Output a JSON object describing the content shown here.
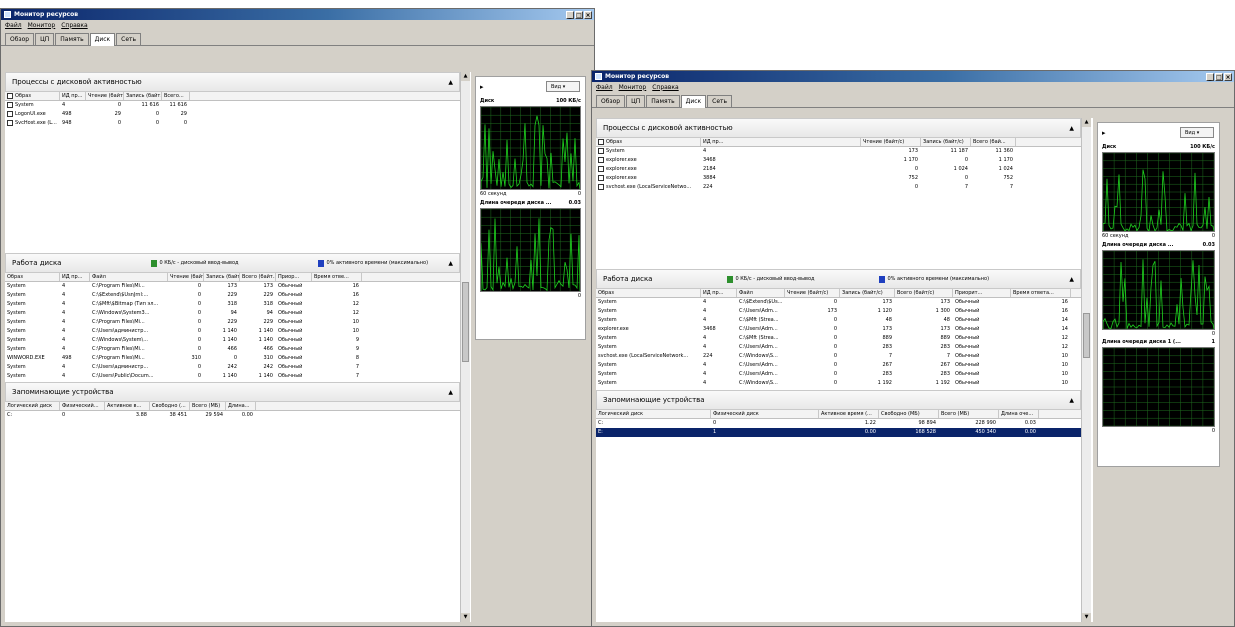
{
  "windows": [
    {
      "title": "Монитор ресурсов",
      "menu": [
        "Файл",
        "Монитор",
        "Справка"
      ],
      "tabs": [
        "Обзор",
        "ЦП",
        "Память",
        "Диск",
        "Сеть"
      ],
      "active_tab": 3,
      "processes": {
        "header": "Процессы с дисковой активностью",
        "columns": [
          "Образ",
          "ИД пр...",
          "Чтение (байт...",
          "Запись (байт...",
          "Всего..."
        ],
        "rows": [
          [
            "System",
            "4",
            "0",
            "11 616",
            "11 616"
          ],
          [
            "LogonUI.exe",
            "498",
            "29",
            "0",
            "29"
          ],
          [
            "SvcHost.exe (L...",
            "948",
            "0",
            "0",
            "0"
          ]
        ]
      },
      "disk": {
        "header": "Работа диска",
        "legend_io": "0 КБ/с - дисковый ввод-вывод",
        "legend_active": "0% активного времени (максимально)",
        "columns": [
          "Образ",
          "ИД пр...",
          "Файл",
          "Чтение (байт...",
          "Запись (байт...",
          "Всего (байт...",
          "Приор...",
          "Время отве..."
        ],
        "rows": [
          [
            "System",
            "4",
            "C:\\Program Files\\Mi...",
            "0",
            "173",
            "173",
            "Обычный",
            "16"
          ],
          [
            "System",
            "4",
            "C:\\$Extend\\$UsnJrnl:...",
            "0",
            "229",
            "229",
            "Обычный",
            "16"
          ],
          [
            "System",
            "4",
            "C:\\$Mft\\$Bitmap (Тип эл...",
            "0",
            "318",
            "318",
            "Обычный",
            "12"
          ],
          [
            "System",
            "4",
            "C:\\Windows\\System3...",
            "0",
            "94",
            "94",
            "Обычный",
            "12"
          ],
          [
            "System",
            "4",
            "C:\\Program Files\\Mi...",
            "0",
            "229",
            "229",
            "Обычный",
            "10"
          ],
          [
            "System",
            "4",
            "C:\\Users\\администр...",
            "0",
            "1 140",
            "1 140",
            "Обычный",
            "10"
          ],
          [
            "System",
            "4",
            "C:\\Windows\\System\\...",
            "0",
            "1 140",
            "1 140",
            "Обычный",
            "9"
          ],
          [
            "System",
            "4",
            "C:\\Program Files\\Mi...",
            "0",
            "466",
            "466",
            "Обычный",
            "9"
          ],
          [
            "WINWORD.EXE",
            "498",
            "C:\\Program Files\\Mi...",
            "310",
            "0",
            "310",
            "Обычный",
            "8"
          ],
          [
            "System",
            "4",
            "C:\\Users\\администр...",
            "0",
            "242",
            "242",
            "Обычный",
            "7"
          ],
          [
            "System",
            "4",
            "C:\\Users\\Public\\Docum...",
            "0",
            "1 140",
            "1 140",
            "Обычный",
            "7"
          ]
        ]
      },
      "storage": {
        "header": "Запоминающие устройства",
        "columns": [
          "Логический диск",
          "Физический...",
          "Активное в...",
          "Свободно (...",
          "Всего (МБ)",
          "Длина..."
        ],
        "rows": [
          [
            "C:",
            "0",
            "3.88",
            "38 451",
            "29 594",
            "0.00"
          ]
        ]
      },
      "graphs": {
        "view_label": "Вид",
        "disk_label": "Диск",
        "disk_max": "100 КБ/с",
        "time_label": "60 секунд",
        "time_min": "0",
        "queue_label": "Длина очереди диска ...",
        "queue_max": "0.03",
        "queue_min": "0"
      }
    },
    {
      "title": "Монитор ресурсов",
      "menu": [
        "Файл",
        "Монитор",
        "Справка"
      ],
      "tabs": [
        "Обзор",
        "ЦП",
        "Память",
        "Диск",
        "Сеть"
      ],
      "active_tab": 3,
      "processes": {
        "header": "Процессы с дисковой активностью",
        "columns": [
          "Образ",
          "ИД пр...",
          "Чтение (байт/с)",
          "Запись (байт/с)",
          "Всего (бай..."
        ],
        "rows": [
          [
            "System",
            "4",
            "173",
            "11 187",
            "11 360"
          ],
          [
            "explorer.exe",
            "3468",
            "1 170",
            "0",
            "1 170"
          ],
          [
            "explorer.exe",
            "2184",
            "0",
            "1 024",
            "1 024"
          ],
          [
            "explorer.exe",
            "3884",
            "752",
            "0",
            "752"
          ],
          [
            "svchost.exe (LocalServiceNetwo...",
            "224",
            "0",
            "7",
            "7"
          ]
        ]
      },
      "disk": {
        "header": "Работа диска",
        "legend_io": "0 КБ/с - дисковый ввод-вывод",
        "legend_active": "0% активного времени (максимально)",
        "columns": [
          "Образ",
          "ИД пр...",
          "Файл",
          "Чтение (байт/с)",
          "Запись (байт/с)",
          "Всего (байт/с)",
          "Приорит...",
          "Время ответа..."
        ],
        "rows": [
          [
            "System",
            "4",
            "C:\\$Extend\\$Us...",
            "0",
            "173",
            "173",
            "Обычный",
            "16"
          ],
          [
            "System",
            "4",
            "C:\\Users\\Adm...",
            "173",
            "1 120",
            "1 300",
            "Обычный",
            "16"
          ],
          [
            "System",
            "4",
            "C:\\$Mft (Strea...",
            "0",
            "48",
            "48",
            "Обычный",
            "14"
          ],
          [
            "explorer.exe",
            "3468",
            "C:\\Users\\Adm...",
            "0",
            "173",
            "173",
            "Обычный",
            "14"
          ],
          [
            "System",
            "4",
            "C:\\$Mft (Strea...",
            "0",
            "889",
            "889",
            "Обычный",
            "12"
          ],
          [
            "System",
            "4",
            "C:\\Users\\Adm...",
            "0",
            "283",
            "283",
            "Обычный",
            "12"
          ],
          [
            "svchost.exe (LocalServiceNetwork...",
            "224",
            "C:\\Windows\\S...",
            "0",
            "7",
            "7",
            "Обычный",
            "10"
          ],
          [
            "System",
            "4",
            "C:\\Users\\Adm...",
            "0",
            "267",
            "267",
            "Обычный",
            "10"
          ],
          [
            "System",
            "4",
            "C:\\Users\\Adm...",
            "0",
            "283",
            "283",
            "Обычный",
            "10"
          ],
          [
            "System",
            "4",
            "C:\\Windows\\S...",
            "0",
            "1 192",
            "1 192",
            "Обычный",
            "10"
          ]
        ]
      },
      "storage": {
        "header": "Запоминающие устройства",
        "columns": [
          "Логический диск",
          "Физический диск",
          "Активное время (...",
          "Свободно (МБ)",
          "Всего (МБ)",
          "Длина оче..."
        ],
        "rows": [
          [
            "C:",
            "0",
            "1.22",
            "98 894",
            "228 990",
            "0.03"
          ],
          [
            "E:",
            "1",
            "0.00",
            "168 528",
            "450 340",
            "0.00"
          ]
        ],
        "selected_row": 1
      },
      "graphs": {
        "view_label": "Вид",
        "disk_label": "Диск",
        "disk_max": "100 КБ/с",
        "time_label": "60 секунд",
        "time_min": "0",
        "queue_label": "Длина очереди диска ...",
        "queue_max": "0.03",
        "queue_min": "0",
        "queue2_label": "Длина очереди диска 1 (...",
        "queue2_max": "1",
        "queue2_min": "0"
      }
    }
  ],
  "colors": {
    "graph_bg": "#000000",
    "graph_line": "#1fd21f",
    "graph_grid": "#1f6b1f",
    "legend_io": "#2d8f2d",
    "legend_active": "#1f3fbf",
    "selection": "#0a246a"
  }
}
